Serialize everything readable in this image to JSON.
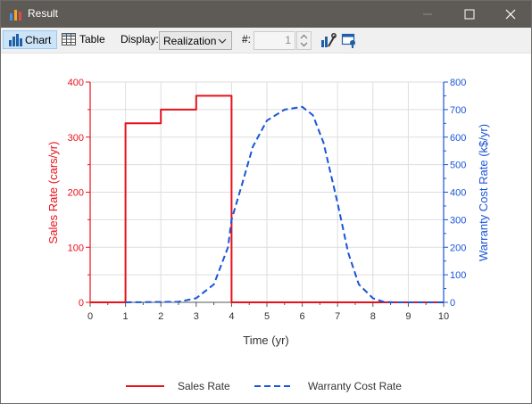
{
  "window": {
    "title": "Result"
  },
  "toolbar": {
    "chart_label": "Chart",
    "table_label": "Table",
    "display_label": "Display:",
    "display_value": "Realization",
    "number_label": "#:",
    "number_value": "1"
  },
  "colors": {
    "sales": "#e8101a",
    "warranty": "#1a55d8",
    "grid": "#dedede"
  },
  "chart_data": {
    "type": "line",
    "xlabel": "Time (yr)",
    "ylabel_left": "Sales Rate (cars/yr)",
    "ylabel_right": "Warranty Cost Rate (k$/yr)",
    "xlim": [
      0,
      10
    ],
    "ylim_left": [
      0,
      400
    ],
    "ylim_right": [
      0,
      800
    ],
    "x_ticks": [
      "0",
      "1",
      "2",
      "3",
      "4",
      "5",
      "6",
      "7",
      "8",
      "9",
      "10"
    ],
    "y_left_ticks": [
      "0",
      "100",
      "200",
      "300",
      "400"
    ],
    "y_right_ticks": [
      "0",
      "100",
      "200",
      "300",
      "400",
      "500",
      "600",
      "700",
      "800"
    ],
    "grid": true,
    "legend_position": "bottom",
    "series": [
      {
        "name": "Sales Rate",
        "axis": "left",
        "style": "solid",
        "x": [
          0,
          1,
          1,
          2,
          2,
          3,
          3,
          4,
          4,
          10
        ],
        "y": [
          0,
          0,
          325,
          325,
          350,
          350,
          375,
          375,
          0,
          0
        ]
      },
      {
        "name": "Warranty Cost Rate",
        "axis": "right",
        "style": "dashed",
        "x": [
          1,
          2.5,
          3,
          3.5,
          3.9,
          4,
          4.3,
          4.6,
          5,
          5.5,
          6,
          6.3,
          6.6,
          7,
          7.3,
          7.6,
          8,
          8.3,
          8.6,
          9,
          10
        ],
        "y": [
          0,
          2,
          15,
          65,
          200,
          300,
          430,
          565,
          660,
          700,
          710,
          680,
          580,
          360,
          180,
          65,
          15,
          2,
          0,
          0,
          0
        ]
      }
    ]
  }
}
